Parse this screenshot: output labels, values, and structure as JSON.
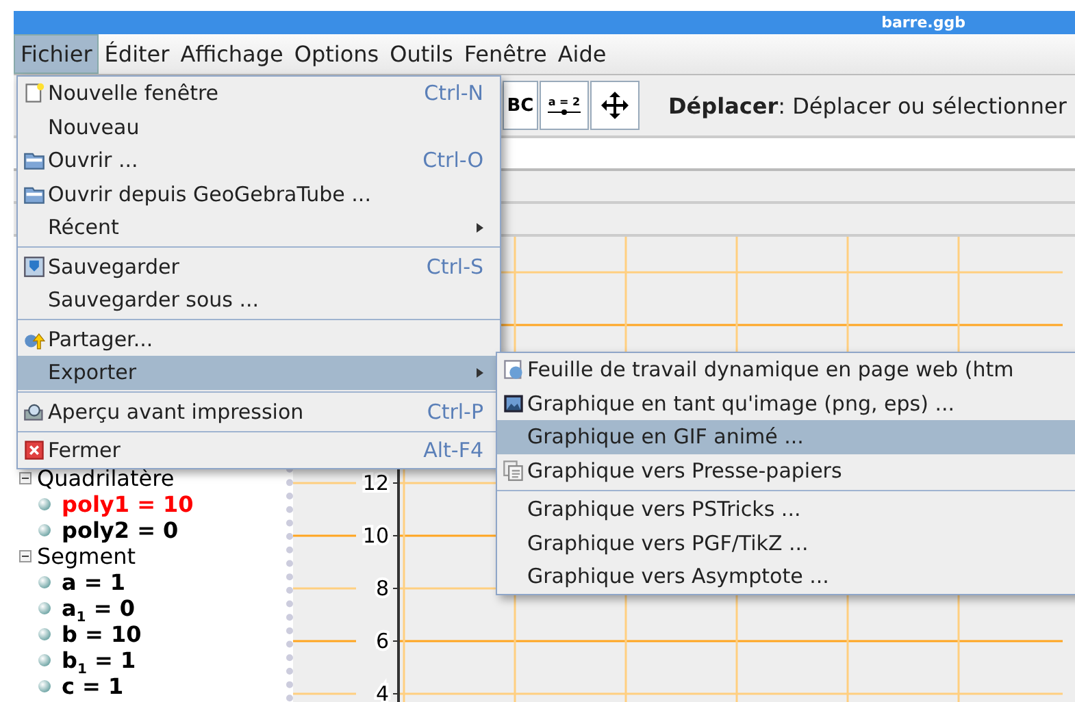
{
  "title_bar": {
    "title": "barre.ggb"
  },
  "menubar": [
    {
      "label": "Fichier",
      "selected": true
    },
    {
      "label": "Éditer",
      "selected": false
    },
    {
      "label": "Affichage",
      "selected": false
    },
    {
      "label": "Options",
      "selected": false
    },
    {
      "label": "Outils",
      "selected": false
    },
    {
      "label": "Fenêtre",
      "selected": false
    },
    {
      "label": "Aide",
      "selected": false
    }
  ],
  "toolbar": {
    "tools": [
      {
        "kind": "text",
        "label": "BC"
      },
      {
        "kind": "slider",
        "label": "a = 2"
      },
      {
        "kind": "move"
      }
    ],
    "help": "**Déplacer**: Déplacer ou sélectionner"
  },
  "algebra": {
    "groups": [
      {
        "label": "Quadrilatère",
        "expanded": true,
        "items": [
          {
            "text": "poly1 = 10",
            "color": "#ff0000"
          },
          {
            "text": "poly2 = 0",
            "color": "#000000"
          }
        ]
      },
      {
        "label": "Segment",
        "expanded": true,
        "items": [
          {
            "text": "a = 1",
            "color": "#000000"
          },
          {
            "text": "a$_{1}$ = 0",
            "color": "#000000"
          },
          {
            "text": "b = 10",
            "color": "#000000"
          },
          {
            "text": "b$_{1}$ = 1",
            "color": "#000000"
          },
          {
            "text": "c = 1",
            "color": "#000000"
          }
        ]
      }
    ]
  },
  "graphics": {
    "y_ticks": [
      "12",
      "10",
      "8",
      "6",
      "4"
    ]
  },
  "file_menu": {
    "items": [
      {
        "kind": "page",
        "label": "Nouvelle fenêtre",
        "shortcut": "Ctrl-N",
        "has_submenu": false,
        "selected": false
      },
      {
        "kind": "plain",
        "label": "Nouveau",
        "has_submenu": false,
        "selected": false
      },
      {
        "kind": "folder",
        "label": "Ouvrir ...",
        "shortcut": "Ctrl-O",
        "has_submenu": false,
        "selected": false
      },
      {
        "kind": "folder",
        "label": "Ouvrir depuis GeoGebraTube ...",
        "has_submenu": false,
        "selected": false
      },
      {
        "kind": "plain",
        "label": "Récent",
        "has_submenu": true,
        "selected": false
      },
      {
        "kind": "separator"
      },
      {
        "kind": "disk",
        "label": "Sauvegarder",
        "shortcut": "Ctrl-S",
        "has_submenu": false,
        "selected": false
      },
      {
        "kind": "plain",
        "label": "Sauvegarder sous ...",
        "has_submenu": false,
        "selected": false
      },
      {
        "kind": "separator"
      },
      {
        "kind": "share",
        "label": "Partager...",
        "has_submenu": false,
        "selected": false
      },
      {
        "kind": "plain",
        "label": "Exporter",
        "has_submenu": true,
        "selected": true
      },
      {
        "kind": "separator"
      },
      {
        "kind": "preview",
        "label": "Aperçu avant impression",
        "shortcut": "Ctrl-P",
        "has_submenu": false,
        "selected": false
      },
      {
        "kind": "separator"
      },
      {
        "kind": "close",
        "label": "Fermer",
        "shortcut": "Alt-F4",
        "has_submenu": false,
        "selected": false
      }
    ]
  },
  "export_submenu": {
    "items": [
      {
        "kind": "web",
        "label": "Feuille de travail dynamique en page web (htm",
        "selected": false
      },
      {
        "kind": "image",
        "label": "Graphique en tant qu'image (png, eps) ...",
        "selected": false
      },
      {
        "kind": "plain",
        "label": "Graphique en GIF animé ...",
        "selected": true
      },
      {
        "kind": "clipboard",
        "label": "Graphique vers Presse-papiers",
        "selected": false
      },
      {
        "kind": "separator"
      },
      {
        "kind": "plain",
        "label": "Graphique vers PSTricks ...",
        "selected": false
      },
      {
        "kind": "plain",
        "label": "Graphique vers PGF/TikZ ...",
        "selected": false
      },
      {
        "kind": "plain",
        "label": "Graphique vers Asymptote ...",
        "selected": false
      }
    ]
  }
}
